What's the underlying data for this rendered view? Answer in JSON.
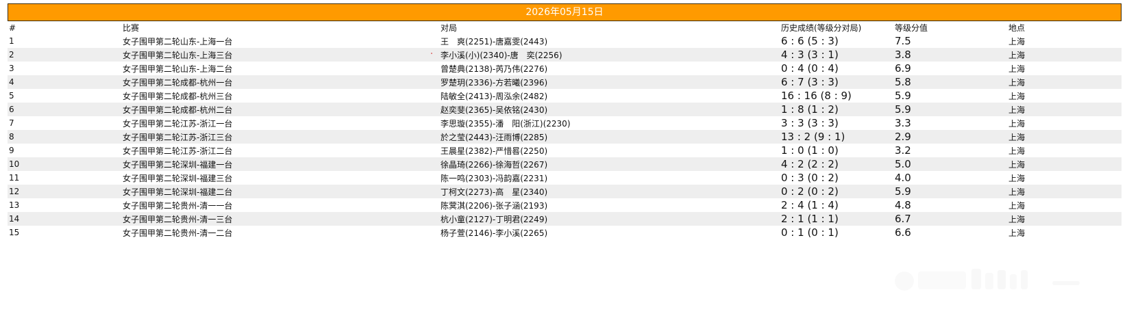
{
  "title": "2026年05月15日",
  "columns": [
    "#",
    "比赛",
    "对局",
    "历史成绩(等级分对局)",
    "等级分值",
    "地点"
  ],
  "rows": [
    {
      "num": "1",
      "event": "女子围甲第二轮山东-上海一台",
      "match": "王　爽(2251)-唐嘉雯(2443)",
      "record": "6 : 6 (5 : 3)",
      "diff": "7.5",
      "place": "上海"
    },
    {
      "num": "2",
      "event": "女子围甲第二轮山东-上海三台",
      "match": "李小溪(小)(2340)-唐　奕(2256)",
      "record": "4 : 3 (3 : 1)",
      "diff": "3.8",
      "place": "上海"
    },
    {
      "num": "3",
      "event": "女子围甲第二轮山东-上海二台",
      "match": "曾楚典(2138)-芮乃伟(2276)",
      "record": "0 : 4 (0 : 4)",
      "diff": "6.9",
      "place": "上海"
    },
    {
      "num": "4",
      "event": "女子围甲第二轮成都-杭州一台",
      "match": "罗楚玥(2336)-方若曦(2396)",
      "record": "6 : 7 (3 : 3)",
      "diff": "5.8",
      "place": "上海"
    },
    {
      "num": "5",
      "event": "女子围甲第二轮成都-杭州三台",
      "match": "陆敏全(2413)-周泓余(2482)",
      "record": "16 : 16 (8 : 9)",
      "diff": "5.9",
      "place": "上海"
    },
    {
      "num": "6",
      "event": "女子围甲第二轮成都-杭州二台",
      "match": "赵奕斐(2365)-吴依铭(2430)",
      "record": "1 : 8 (1 : 2)",
      "diff": "5.9",
      "place": "上海"
    },
    {
      "num": "7",
      "event": "女子围甲第二轮江苏-浙江一台",
      "match": "李思璇(2355)-潘　阳(浙江)(2230)",
      "record": "3 : 3 (3 : 3)",
      "diff": "3.3",
      "place": "上海"
    },
    {
      "num": "8",
      "event": "女子围甲第二轮江苏-浙江三台",
      "match": "於之莹(2443)-汪雨博(2285)",
      "record": "13 : 2 (9 : 1)",
      "diff": "2.9",
      "place": "上海"
    },
    {
      "num": "9",
      "event": "女子围甲第二轮江苏-浙江二台",
      "match": "王晨星(2382)-严惜晷(2250)",
      "record": "1 : 0 (1 : 0)",
      "diff": "3.2",
      "place": "上海"
    },
    {
      "num": "10",
      "event": "女子围甲第二轮深圳-福建一台",
      "match": "徐晶琦(2266)-徐海哲(2267)",
      "record": "4 : 2 (2 : 2)",
      "diff": "5.0",
      "place": "上海"
    },
    {
      "num": "11",
      "event": "女子围甲第二轮深圳-福建三台",
      "match": "陈一鸣(2303)-冯韵嘉(2231)",
      "record": "0 : 3 (0 : 2)",
      "diff": "4.0",
      "place": "上海"
    },
    {
      "num": "12",
      "event": "女子围甲第二轮深圳-福建二台",
      "match": "丁柯文(2273)-高　星(2340)",
      "record": "0 : 2 (0 : 2)",
      "diff": "5.9",
      "place": "上海"
    },
    {
      "num": "13",
      "event": "女子围甲第二轮贵州-清一一台",
      "match": "陈蓂淇(2206)-张子涵(2193)",
      "record": "2 : 4 (1 : 4)",
      "diff": "4.8",
      "place": "上海"
    },
    {
      "num": "14",
      "event": "女子围甲第二轮贵州-清一三台",
      "match": "杭小童(2127)-丁明君(2249)",
      "record": "2 : 1 (1 : 1)",
      "diff": "6.7",
      "place": "上海"
    },
    {
      "num": "15",
      "event": "女子围甲第二轮贵州-清一二台",
      "match": "杨子萱(2146)-李小溪(2265)",
      "record": "0 : 1 (0 : 1)",
      "diff": "6.6",
      "place": "上海"
    }
  ],
  "colors": {
    "title_bar": "#ff9a00",
    "alt_row": "#eeeeee"
  },
  "icons": {
    "watermark": "watermark-logo-icon"
  }
}
